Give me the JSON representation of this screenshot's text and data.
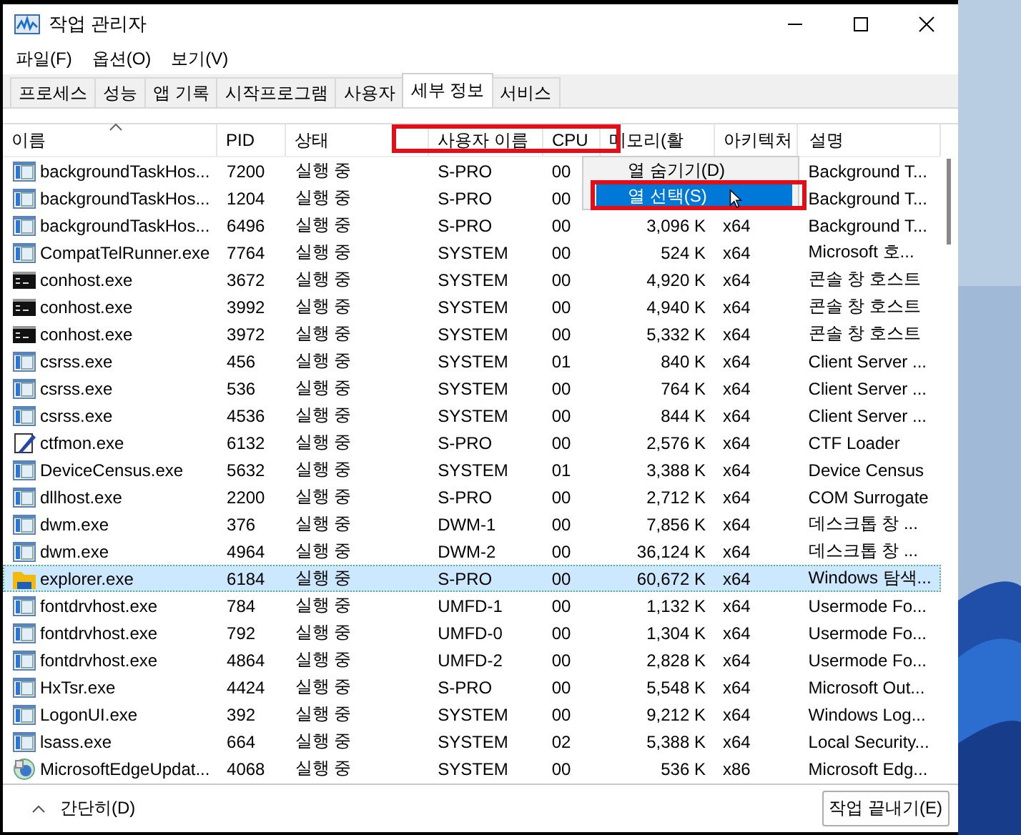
{
  "window": {
    "title": "작업 관리자"
  },
  "menu": [
    "파일(F)",
    "옵션(O)",
    "보기(V)"
  ],
  "tabs": [
    {
      "label": "프로세스",
      "selected": false
    },
    {
      "label": "성능",
      "selected": false
    },
    {
      "label": "앱 기록",
      "selected": false
    },
    {
      "label": "시작프로그램",
      "selected": false
    },
    {
      "label": "사용자",
      "selected": false
    },
    {
      "label": "세부 정보",
      "selected": true
    },
    {
      "label": "서비스",
      "selected": false
    }
  ],
  "table": {
    "columns": [
      "이름",
      "PID",
      "상태",
      "사용자 이름",
      "CPU",
      "메모리(활",
      "아키텍처",
      "설명"
    ],
    "rows": [
      {
        "kind": "app",
        "name": "backgroundTaskHos...",
        "pid": "7200",
        "status": "실행 중",
        "user": "S-PRO",
        "cpu": "00",
        "description": "Background T...",
        "selected": false
      },
      {
        "kind": "app",
        "name": "backgroundTaskHos...",
        "pid": "1204",
        "status": "실행 중",
        "user": "S-PRO",
        "cpu": "00",
        "description": "Background T...",
        "selected": false
      },
      {
        "kind": "app",
        "name": "backgroundTaskHos...",
        "pid": "6496",
        "status": "실행 중",
        "user": "S-PRO",
        "cpu": "00",
        "memory": "3,096 K",
        "arch": "x64",
        "description": "Background T...",
        "selected": false
      },
      {
        "kind": "app",
        "name": "CompatTelRunner.exe",
        "pid": "7764",
        "status": "실행 중",
        "user": "SYSTEM",
        "cpu": "00",
        "memory": "524 K",
        "arch": "x64",
        "description": "Microsoft 호...",
        "selected": false
      },
      {
        "kind": "console",
        "name": "conhost.exe",
        "pid": "3672",
        "status": "실행 중",
        "user": "SYSTEM",
        "cpu": "00",
        "memory": "4,920 K",
        "arch": "x64",
        "description": "콘솔 창 호스트",
        "selected": false
      },
      {
        "kind": "console",
        "name": "conhost.exe",
        "pid": "3992",
        "status": "실행 중",
        "user": "SYSTEM",
        "cpu": "00",
        "memory": "4,940 K",
        "arch": "x64",
        "description": "콘솔 창 호스트",
        "selected": false
      },
      {
        "kind": "console",
        "name": "conhost.exe",
        "pid": "3972",
        "status": "실행 중",
        "user": "SYSTEM",
        "cpu": "00",
        "memory": "5,332 K",
        "arch": "x64",
        "description": "콘솔 창 호스트",
        "selected": false
      },
      {
        "kind": "app",
        "name": "csrss.exe",
        "pid": "456",
        "status": "실행 중",
        "user": "SYSTEM",
        "cpu": "01",
        "memory": "840 K",
        "arch": "x64",
        "description": "Client Server ...",
        "selected": false
      },
      {
        "kind": "app",
        "name": "csrss.exe",
        "pid": "536",
        "status": "실행 중",
        "user": "SYSTEM",
        "cpu": "00",
        "memory": "764 K",
        "arch": "x64",
        "description": "Client Server ...",
        "selected": false
      },
      {
        "kind": "app",
        "name": "csrss.exe",
        "pid": "4536",
        "status": "실행 중",
        "user": "SYSTEM",
        "cpu": "00",
        "memory": "844 K",
        "arch": "x64",
        "description": "Client Server ...",
        "selected": false
      },
      {
        "kind": "pen",
        "name": "ctfmon.exe",
        "pid": "6132",
        "status": "실행 중",
        "user": "S-PRO",
        "cpu": "00",
        "memory": "2,576 K",
        "arch": "x64",
        "description": "CTF Loader",
        "selected": false
      },
      {
        "kind": "app",
        "name": "DeviceCensus.exe",
        "pid": "5632",
        "status": "실행 중",
        "user": "SYSTEM",
        "cpu": "01",
        "memory": "3,388 K",
        "arch": "x64",
        "description": "Device Census",
        "selected": false
      },
      {
        "kind": "app",
        "name": "dllhost.exe",
        "pid": "2200",
        "status": "실행 중",
        "user": "S-PRO",
        "cpu": "00",
        "memory": "2,712 K",
        "arch": "x64",
        "description": "COM Surrogate",
        "selected": false
      },
      {
        "kind": "app",
        "name": "dwm.exe",
        "pid": "376",
        "status": "실행 중",
        "user": "DWM-1",
        "cpu": "00",
        "memory": "7,856 K",
        "arch": "x64",
        "description": "데스크톱 창 ...",
        "selected": false
      },
      {
        "kind": "app",
        "name": "dwm.exe",
        "pid": "4964",
        "status": "실행 중",
        "user": "DWM-2",
        "cpu": "00",
        "memory": "36,124 K",
        "arch": "x64",
        "description": "데스크톱 창 ...",
        "selected": false
      },
      {
        "kind": "folder",
        "name": "explorer.exe",
        "pid": "6184",
        "status": "실행 중",
        "user": "S-PRO",
        "cpu": "00",
        "memory": "60,672 K",
        "arch": "x64",
        "description": "Windows 탐색...",
        "selected": true
      },
      {
        "kind": "app",
        "name": "fontdrvhost.exe",
        "pid": "784",
        "status": "실행 중",
        "user": "UMFD-1",
        "cpu": "00",
        "memory": "1,132 K",
        "arch": "x64",
        "description": "Usermode Fo...",
        "selected": false
      },
      {
        "kind": "app",
        "name": "fontdrvhost.exe",
        "pid": "792",
        "status": "실행 중",
        "user": "UMFD-0",
        "cpu": "00",
        "memory": "1,304 K",
        "arch": "x64",
        "description": "Usermode Fo...",
        "selected": false
      },
      {
        "kind": "app",
        "name": "fontdrvhost.exe",
        "pid": "4864",
        "status": "실행 중",
        "user": "UMFD-2",
        "cpu": "00",
        "memory": "2,828 K",
        "arch": "x64",
        "description": "Usermode Fo...",
        "selected": false
      },
      {
        "kind": "app",
        "name": "HxTsr.exe",
        "pid": "4424",
        "status": "실행 중",
        "user": "S-PRO",
        "cpu": "00",
        "memory": "5,548 K",
        "arch": "x64",
        "description": "Microsoft Out...",
        "selected": false
      },
      {
        "kind": "app",
        "name": "LogonUI.exe",
        "pid": "392",
        "status": "실행 중",
        "user": "SYSTEM",
        "cpu": "00",
        "memory": "9,212 K",
        "arch": "x64",
        "description": "Windows Log...",
        "selected": false
      },
      {
        "kind": "app",
        "name": "lsass.exe",
        "pid": "664",
        "status": "실행 중",
        "user": "SYSTEM",
        "cpu": "02",
        "memory": "5,388 K",
        "arch": "x64",
        "description": "Local Security...",
        "selected": false
      },
      {
        "kind": "edge",
        "name": "MicrosoftEdgeUpdat...",
        "pid": "4068",
        "status": "실행 중",
        "user": "SYSTEM",
        "cpu": "00",
        "memory": "536 K",
        "arch": "x86",
        "description": "Microsoft Edg...",
        "selected": false
      }
    ]
  },
  "context_menu": {
    "items": [
      {
        "label": "열 숨기기(D)",
        "selected": false
      },
      {
        "label": "열 선택(S)",
        "selected": true
      }
    ]
  },
  "footer": {
    "toggle": "간단히(D)",
    "end_task": "작업 끝내기(E)"
  }
}
